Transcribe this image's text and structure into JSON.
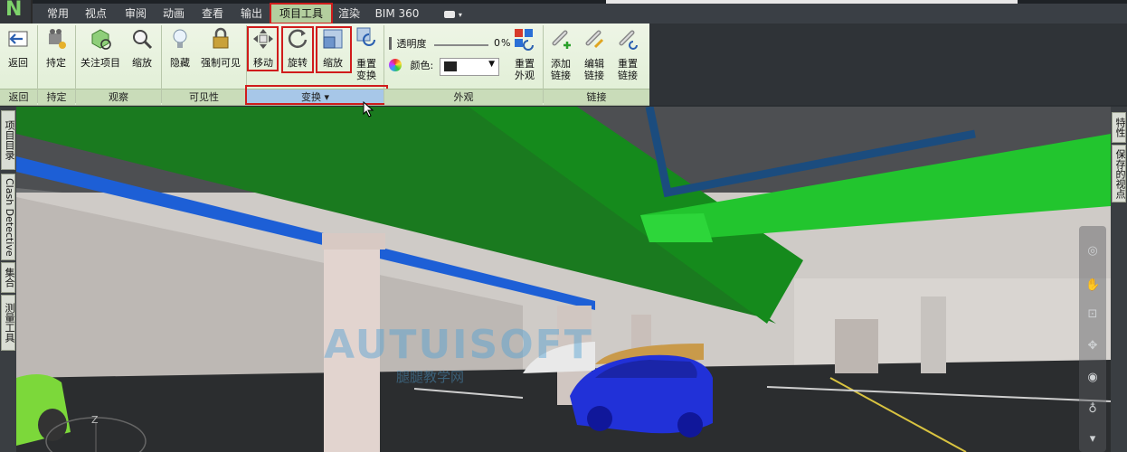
{
  "menu_tabs": [
    {
      "label": "常用"
    },
    {
      "label": "视点"
    },
    {
      "label": "审阅"
    },
    {
      "label": "动画"
    },
    {
      "label": "查看"
    },
    {
      "label": "输出"
    },
    {
      "label": "项目工具",
      "active": true
    },
    {
      "label": "渲染"
    },
    {
      "label": "BIM 360"
    }
  ],
  "ribbon": {
    "groups": {
      "back": {
        "label": "返回",
        "buttons": [
          "返回"
        ]
      },
      "hold": {
        "label": "持定",
        "buttons": [
          "持定"
        ]
      },
      "observe": {
        "label": "观察",
        "buttons": [
          "关注项目",
          "缩放"
        ]
      },
      "visibility": {
        "label": "可见性",
        "buttons": [
          "隐藏",
          "强制可见"
        ]
      },
      "transform": {
        "label": "变换 ▾",
        "buttons": [
          "移动",
          "旋转",
          "缩放",
          "重置变换"
        ],
        "reset_line1": "重置",
        "reset_line2": "变换"
      },
      "appearance": {
        "label": "外观",
        "transparency_label": "透明度",
        "transparency_value": "0",
        "transparency_unit": "%",
        "color_label": "颜色:",
        "reset_line1": "重置",
        "reset_line2": "外观"
      },
      "links": {
        "label": "链接",
        "add_line1": "添加",
        "add_line2": "链接",
        "edit_line1": "编辑",
        "edit_line2": "链接",
        "reset_line1": "重置",
        "reset_line2": "链接"
      }
    }
  },
  "left_panels": [
    {
      "label": "项目目录"
    },
    {
      "label": "Clash Detective"
    },
    {
      "label": "集合"
    },
    {
      "label": "测量工具"
    }
  ],
  "right_panels": [
    {
      "label": "特性"
    },
    {
      "label": "保存的视点"
    }
  ],
  "viewport": {
    "watermark": "AUTUISOFT",
    "watermark_sub": "腿腿教学网",
    "axis_label": "Z"
  },
  "colors": {
    "accent_green": "#b3ce9e",
    "highlight_red": "#d01c1c",
    "pipe_green": "#1db82a",
    "pipe_blue": "#1d5fd6",
    "car_blue": "#2131d8"
  }
}
